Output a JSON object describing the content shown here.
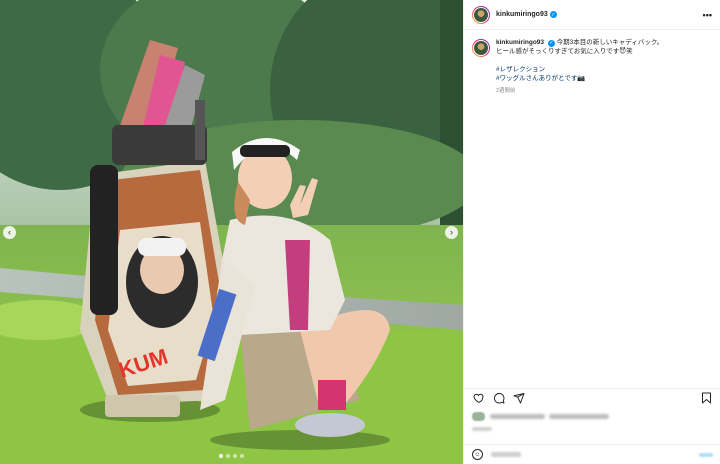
{
  "post": {
    "username": "kinkumiringo93",
    "verified_icon": "verified-badge-icon",
    "more_icon": "more-horizontal-icon",
    "more_label": "•••"
  },
  "caption": {
    "username": "kinkumiringo93",
    "line1": "今期3本目の新しいキャディバック。",
    "line2": "ヒール感がそっくりすぎてお気に入りです😈笑",
    "tag1": "#レザレクション",
    "tag2": "#ワッグルさんありがとです📷",
    "time": "2週間前"
  },
  "photo": {
    "prev_label": "‹",
    "next_label": "›",
    "slides": 4,
    "active_slide": 1,
    "bag_text": "KUM",
    "description_icons": [
      "chevron-left-icon",
      "chevron-right-icon"
    ]
  },
  "actions": {
    "like_icon": "heart-icon",
    "comment_icon": "comment-icon",
    "share_icon": "send-icon",
    "save_icon": "bookmark-icon"
  },
  "comment_box": {
    "emoji_icon": "emoji-icon",
    "emoji_label": "☺"
  },
  "colors": {
    "verified": "#0095f6",
    "hashtag": "#00376b",
    "text": "#262626",
    "muted": "#8e8e8e"
  }
}
